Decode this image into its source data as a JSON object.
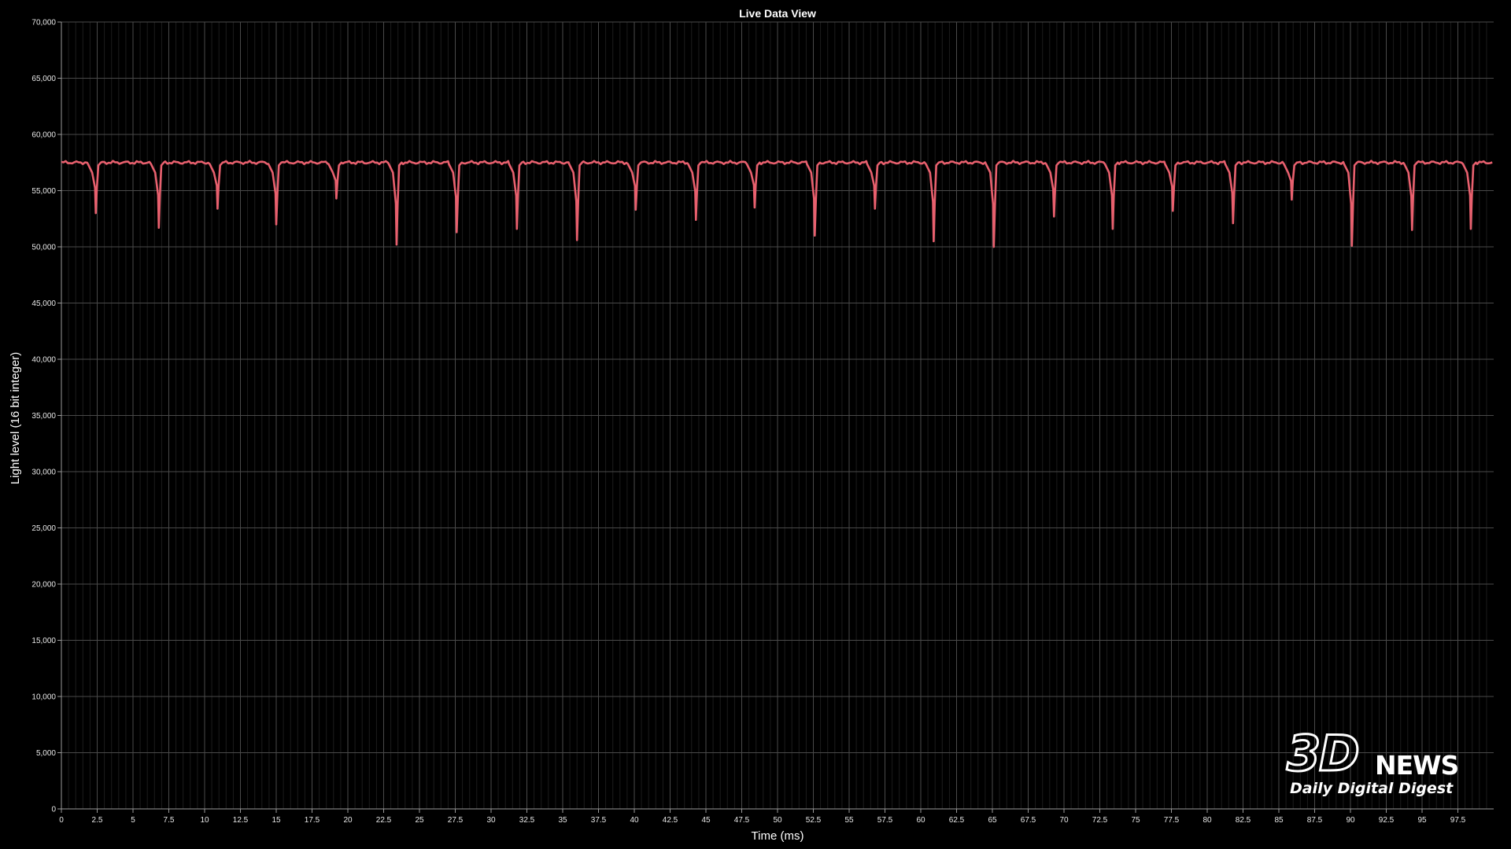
{
  "chart_data": {
    "type": "line",
    "title": "Live Data View",
    "xlabel": "Time (ms)",
    "ylabel": "Light level (16 bit integer)",
    "xlim": [
      0,
      100
    ],
    "ylim": [
      0,
      70000
    ],
    "x_ticks": [
      "0",
      "2.5",
      "5",
      "7.5",
      "10",
      "12.5",
      "15",
      "17.5",
      "20",
      "22.5",
      "25",
      "27.5",
      "30",
      "32.5",
      "35",
      "37.5",
      "40",
      "42.5",
      "45",
      "47.5",
      "50",
      "52.5",
      "55",
      "57.5",
      "60",
      "62.5",
      "65",
      "67.5",
      "70",
      "72.5",
      "75",
      "77.5",
      "80",
      "82.5",
      "85",
      "87.5",
      "90",
      "92.5",
      "95",
      "97.5"
    ],
    "y_ticks": [
      "0",
      "5,000",
      "10,000",
      "15,000",
      "20,000",
      "25,000",
      "30,000",
      "35,000",
      "40,000",
      "45,000",
      "50,000",
      "55,000",
      "60,000",
      "65,000",
      "70,000"
    ],
    "grid": true,
    "series": [
      {
        "color": "#e8606e",
        "baseline": 57500,
        "dips": [
          {
            "x": 2.4,
            "y": 53000
          },
          {
            "x": 6.8,
            "y": 51700
          },
          {
            "x": 10.9,
            "y": 53400
          },
          {
            "x": 15.0,
            "y": 52000
          },
          {
            "x": 19.2,
            "y": 54300
          },
          {
            "x": 23.4,
            "y": 50200
          },
          {
            "x": 27.6,
            "y": 51300
          },
          {
            "x": 31.8,
            "y": 51600
          },
          {
            "x": 36.0,
            "y": 50600
          },
          {
            "x": 40.1,
            "y": 53300
          },
          {
            "x": 44.3,
            "y": 52400
          },
          {
            "x": 48.4,
            "y": 53500
          },
          {
            "x": 52.6,
            "y": 51000
          },
          {
            "x": 56.8,
            "y": 53400
          },
          {
            "x": 60.9,
            "y": 50500
          },
          {
            "x": 65.1,
            "y": 50000
          },
          {
            "x": 69.3,
            "y": 52700
          },
          {
            "x": 73.4,
            "y": 51600
          },
          {
            "x": 77.6,
            "y": 53200
          },
          {
            "x": 81.8,
            "y": 52100
          },
          {
            "x": 85.9,
            "y": 54200
          },
          {
            "x": 90.1,
            "y": 50100
          },
          {
            "x": 94.3,
            "y": 51500
          },
          {
            "x": 98.4,
            "y": 51600
          }
        ]
      }
    ]
  },
  "watermark": {
    "logo_3d": "3D",
    "logo_news": "NEWS",
    "tagline": "Daily Digital Digest"
  }
}
